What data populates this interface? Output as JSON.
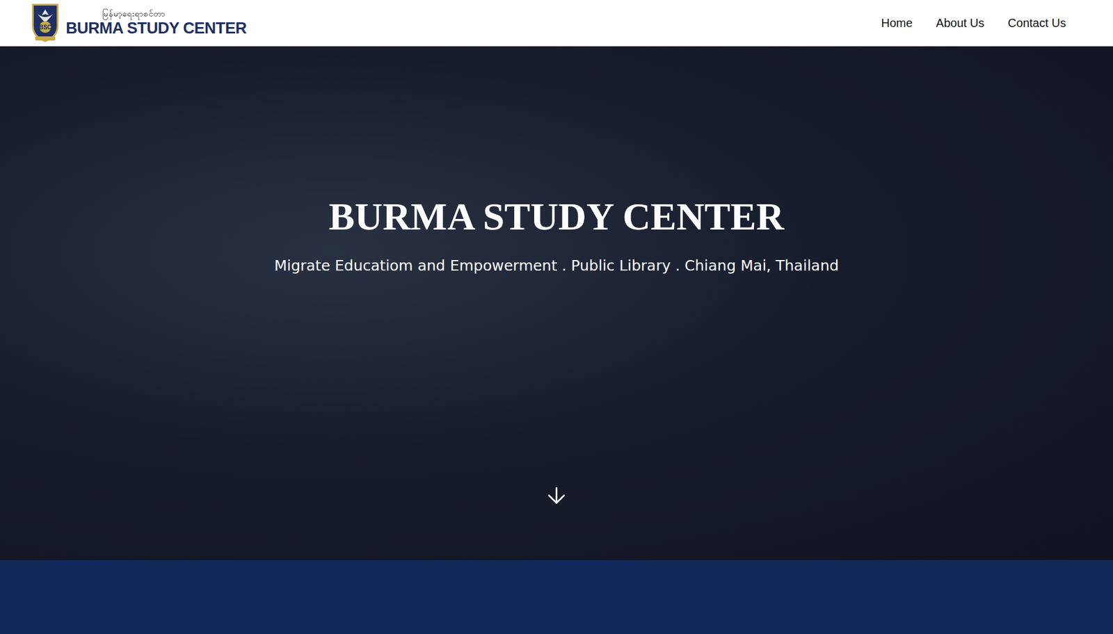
{
  "header": {
    "logo": {
      "badge": "BSC",
      "native_name": "မြန်မာ့ရေးရာစင်တာ",
      "name": "BURMA STUDY CENTER"
    },
    "nav": [
      {
        "label": "Home"
      },
      {
        "label": "About Us"
      },
      {
        "label": "Contact Us"
      }
    ]
  },
  "hero": {
    "title": "BURMA STUDY CENTER",
    "subtitle": "Migrate Educatiom and Empowerment . Public Library . Chiang Mai, Thailand"
  }
}
